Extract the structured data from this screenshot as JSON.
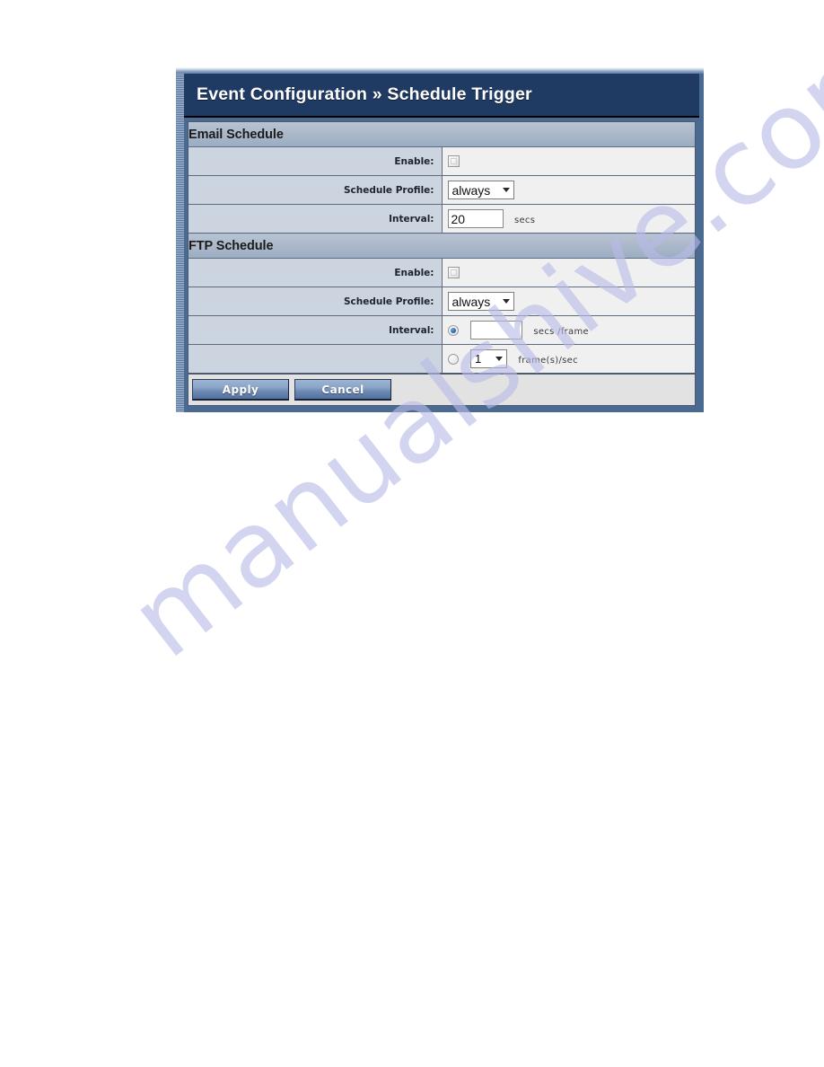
{
  "panel": {
    "title": "Event Configuration » Schedule Trigger"
  },
  "sections": [
    {
      "heading": "Email Schedule",
      "rows": [
        {
          "label": "Enable:",
          "control": "checkbox",
          "checked": false
        },
        {
          "label": "Schedule Profile:",
          "control": "select",
          "value": "always"
        },
        {
          "label": "Interval:",
          "control": "text",
          "value": "20",
          "unit": "secs"
        }
      ]
    },
    {
      "heading": "FTP Schedule",
      "rows": [
        {
          "label": "Enable:",
          "control": "checkbox",
          "checked": false
        },
        {
          "label": "Schedule Profile:",
          "control": "select",
          "value": "always"
        },
        {
          "label": "Interval:",
          "control": "radio-text",
          "value": "",
          "unit": "secs /frame",
          "selected": true
        },
        {
          "label": "",
          "control": "radio-select",
          "value": "1",
          "unit": "frame(s)/sec",
          "selected": false
        }
      ]
    }
  ],
  "buttons": {
    "apply": "Apply",
    "cancel": "Cancel"
  },
  "watermark": {
    "text": "manualshive.com",
    "color": "#b9bbe8"
  }
}
